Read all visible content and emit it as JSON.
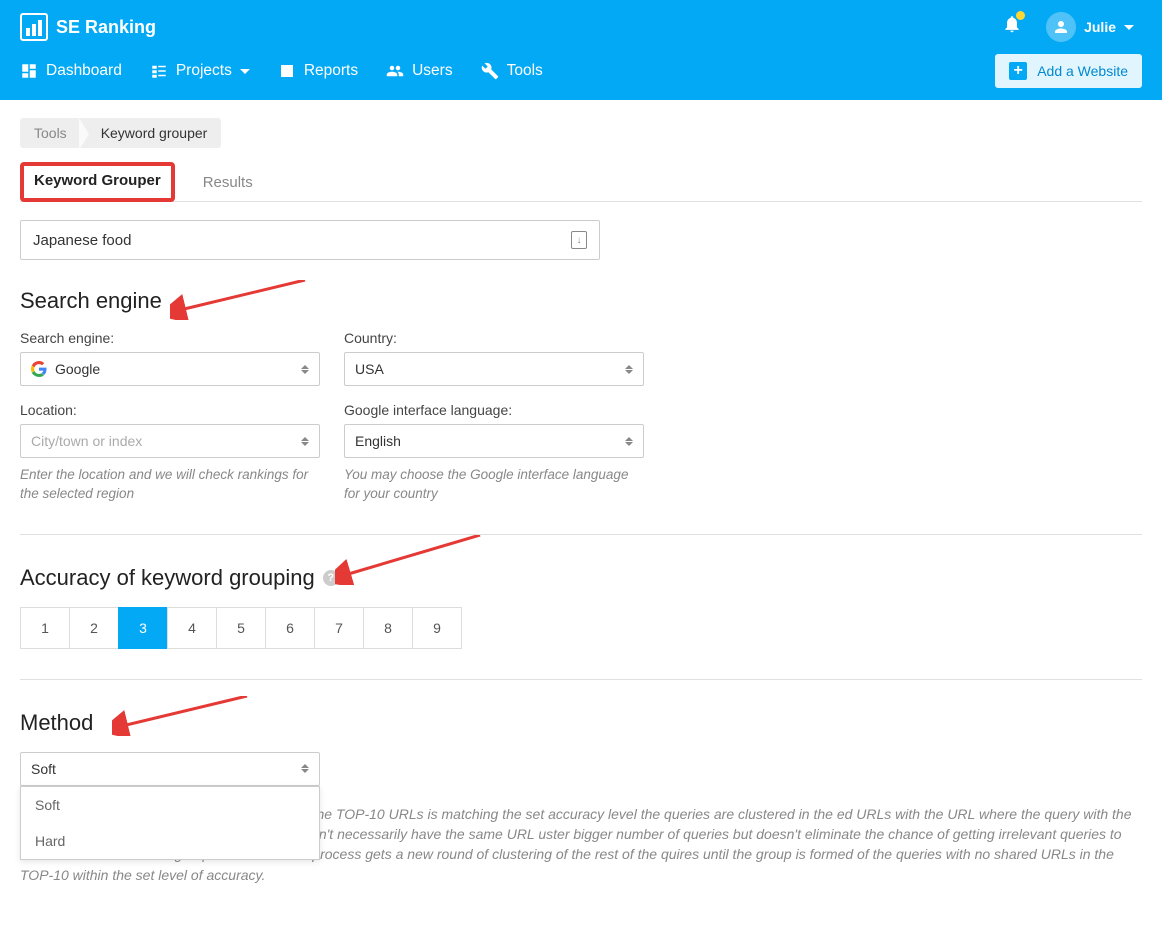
{
  "brand": "SE Ranking",
  "user": {
    "name": "Julie"
  },
  "nav": {
    "items": [
      {
        "label": "Dashboard"
      },
      {
        "label": "Projects"
      },
      {
        "label": "Reports"
      },
      {
        "label": "Users"
      },
      {
        "label": "Tools"
      }
    ],
    "add_website": "Add a Website"
  },
  "breadcrumb": {
    "first": "Tools",
    "second": "Keyword grouper"
  },
  "tabs": {
    "grouper": "Keyword Grouper",
    "results": "Results"
  },
  "input": {
    "value": "Japanese food"
  },
  "sections": {
    "search_engine": "Search engine",
    "accuracy": "Accuracy of keyword grouping",
    "method": "Method"
  },
  "labels": {
    "search_engine": "Search engine:",
    "country": "Country:",
    "location": "Location:",
    "language": "Google interface language:"
  },
  "values": {
    "search_engine": "Google",
    "country": "USA",
    "location_placeholder": "City/town or index",
    "language": "English",
    "method": "Soft"
  },
  "hints": {
    "location": "Enter the location and we will check rankings for the selected region",
    "language": "You may choose the Google interface language for your country"
  },
  "accuracy": {
    "options": [
      "1",
      "2",
      "3",
      "4",
      "5",
      "6",
      "7",
      "8",
      "9"
    ],
    "selected": "3"
  },
  "method_options": {
    "soft": "Soft",
    "hard": "Hard"
  },
  "description": "the largest search volume and if the number of the TOP-10 URLs is matching the set accuracy level the queries are clustered in the ed URLs with the URL where the query with the highest search volume is present but they wouldn't necessarily have the same URL uster bigger number of queries but doesn't eliminate the chance of getting irrelevant queries to the cluster. After the first group is clustered the process gets a new round of clustering of the rest of the quires until the group is formed of the queries with no shared URLs in the TOP-10 within the set level of accuracy."
}
